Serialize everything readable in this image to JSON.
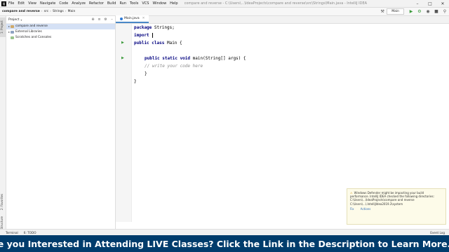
{
  "menubar": {
    "logo": "IJ",
    "items": [
      "File",
      "Edit",
      "View",
      "Navigate",
      "Code",
      "Analyze",
      "Refactor",
      "Build",
      "Run",
      "Tools",
      "VCS",
      "Window",
      "Help"
    ],
    "window_title": "compare and reverse - C:\\Users\\...\\IdeaProjects\\compare and reverse\\src\\Strings\\Main.java - IntelliJ IDEA"
  },
  "navbar": {
    "crumbs": [
      "compare and reverse",
      "src",
      "Strings",
      "Main"
    ],
    "run_config": "Main"
  },
  "leftstrip": {
    "top_label": "1: Project",
    "mid_label": "2: Favorites",
    "bottom_label": "Z: Structure"
  },
  "project": {
    "title": "Project",
    "rows": [
      {
        "label": "compare and reverse",
        "kind": "folder",
        "selected": true
      },
      {
        "label": "External Libraries",
        "kind": "lib",
        "selected": false
      },
      {
        "label": "Scratches and Consoles",
        "kind": "scr",
        "selected": false
      }
    ]
  },
  "editor": {
    "tab_label": "Main.java",
    "lines": {
      "l1_kw": "package",
      "l1_rest": " Strings;",
      "l2_kw": "import",
      "l2_rest": " ",
      "l4_kw": "public class",
      "l4_rest": " Main {",
      "l6_kw": "public static void",
      "l6_rest": " main(String[] args) {",
      "l7_comment": "// write your code here",
      "l8": "}",
      "l9": "}"
    }
  },
  "bottombar": {
    "terminal": "Terminal",
    "todo": "6: TODO",
    "event_log": "Event Log"
  },
  "notification": {
    "text": "Windows Defender might be impacting your build performance. IntelliJ IDEA checked the following directories:",
    "paths": "C:\\Users\\...\\IdeaProjects\\compare and reverse C:\\Users\\...\\.IntelliJIdea2019.3\\system",
    "links": [
      "Fix",
      "Actions"
    ]
  },
  "banner": {
    "text": "Are you Interested in Attending LIVE Classes? Click the Link in the Description to Learn More.",
    "arrow": "↓"
  }
}
